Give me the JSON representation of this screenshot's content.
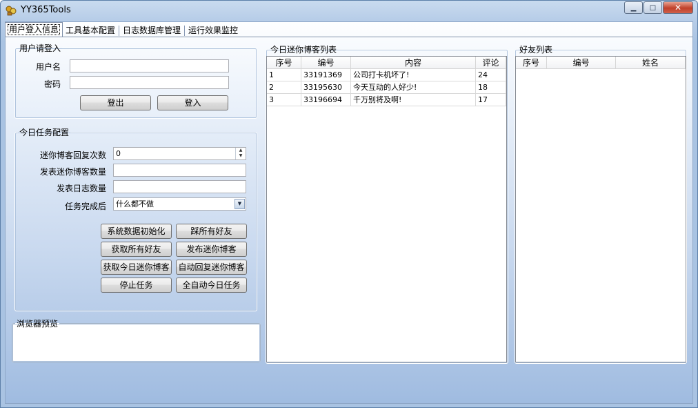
{
  "window": {
    "title": "YY365Tools",
    "minimize_symbol": "▁",
    "maximize_symbol": "□",
    "close_symbol": "✕"
  },
  "tabs": [
    {
      "label": "用户登入信息",
      "active": true
    },
    {
      "label": "工具基本配置",
      "active": false
    },
    {
      "label": "日志数据库管理",
      "active": false
    },
    {
      "label": "运行效果监控",
      "active": false
    }
  ],
  "login": {
    "group_title": "用户请登入",
    "username_label": "用户名",
    "username_value": "",
    "password_label": "密码",
    "password_value": "",
    "logout_label": "登出",
    "login_label": "登入"
  },
  "task_config": {
    "group_title": "今日任务配置",
    "reply_count_label": "迷你博客回复次数",
    "reply_count_value": "0",
    "post_count_label": "发表迷你博客数量",
    "post_count_value": "",
    "log_count_label": "发表日志数量",
    "log_count_value": "",
    "after_done_label": "任务完成后",
    "after_done_value": "什么都不做",
    "buttons": {
      "init": "系统数据初始化",
      "step_friends": "踩所有好友",
      "get_friends": "获取所有好友",
      "post_blog": "发布迷你博客",
      "get_today_blog": "获取今日迷你博客",
      "auto_reply": "自动回复迷你博客",
      "stop_task": "停止任务",
      "auto_all": "全自动今日任务"
    }
  },
  "browser_preview": {
    "group_title": "浏览器预览"
  },
  "blog_list": {
    "group_title": "今日迷你博客列表",
    "columns": [
      "序号",
      "编号",
      "内容",
      "评论"
    ],
    "rows": [
      [
        "1",
        "33191369",
        "公司打卡机坏了!",
        "24"
      ],
      [
        "2",
        "33195630",
        "今天互动的人好少!",
        "18"
      ],
      [
        "3",
        "33196694",
        "千万别将及啊!",
        "17"
      ]
    ]
  },
  "friend_list": {
    "group_title": "好友列表",
    "columns": [
      "序号",
      "编号",
      "姓名"
    ]
  },
  "colors": {
    "accent": "#a9c3e2",
    "close_red": "#c0402a"
  }
}
